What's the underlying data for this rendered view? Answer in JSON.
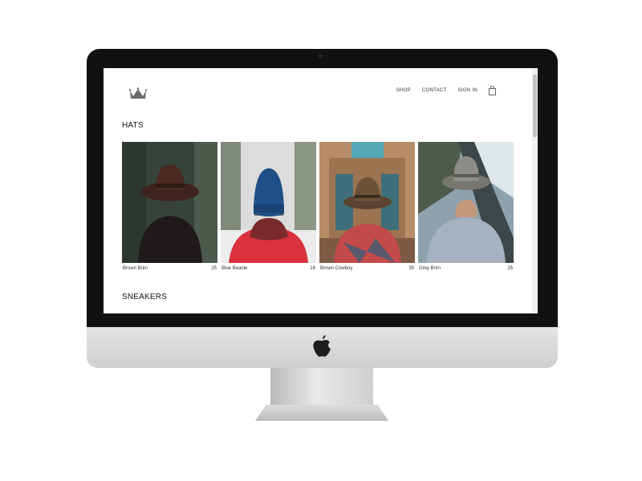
{
  "nav": {
    "links": [
      "SHOP",
      "CONTACT",
      "SIGN IN"
    ],
    "bag_icon": "shopping-bag-icon",
    "logo_icon": "crown-icon"
  },
  "sections": {
    "hats_title": "HATS",
    "sneakers_title": "SNEAKERS"
  },
  "products": [
    {
      "name": "Brown Brim",
      "price": "25",
      "hat_color": "#4a2a22",
      "background": "#3f4a3a"
    },
    {
      "name": "Blue Beanie",
      "price": "18",
      "hat_color": "#1f4f86",
      "background": "#d9d9d9"
    },
    {
      "name": "Brown Cowboy",
      "price": "35",
      "hat_color": "#6b5138",
      "background": "#b48a63"
    },
    {
      "name": "Grey Brim",
      "price": "25",
      "hat_color": "#8d8c86",
      "background": "#6e7b86"
    }
  ],
  "device": {
    "apple_icon": "apple-logo-icon"
  }
}
